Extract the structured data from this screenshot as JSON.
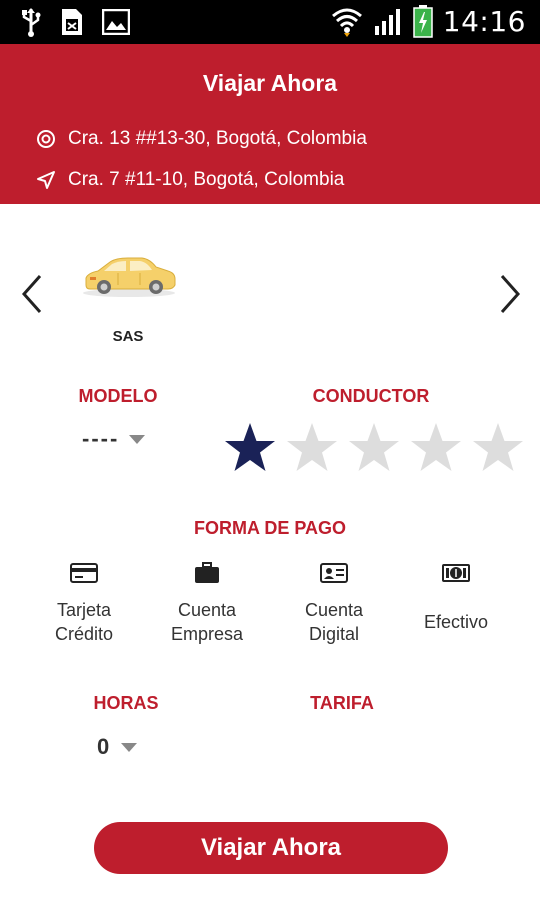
{
  "status_bar": {
    "time": "14:16",
    "icons": [
      "usb-icon",
      "sim-card-icon",
      "image-icon",
      "wifi-icon",
      "signal-icon",
      "battery-icon"
    ]
  },
  "header": {
    "title": "Viajar Ahora",
    "origin_address": "Cra. 13 ##13-30, Bogotá, Colombia",
    "destination_address": "Cra. 7 #11-10, Bogotá, Colombia"
  },
  "vehicle": {
    "selected_label": "SAS",
    "icon": "taxi-car-icon"
  },
  "modelo": {
    "label": "MODELO",
    "value": "----"
  },
  "conductor": {
    "label": "CONDUCTOR",
    "rating": 1,
    "max_rating": 5
  },
  "payment": {
    "label": "FORMA DE PAGO",
    "options": [
      {
        "line1": "Tarjeta",
        "line2": "Crédito",
        "icon": "credit-card-icon"
      },
      {
        "line1": "Cuenta",
        "line2": "Empresa",
        "icon": "briefcase-icon"
      },
      {
        "line1": "Cuenta",
        "line2": "Digital",
        "icon": "id-card-icon"
      },
      {
        "line1": "Efectivo",
        "icon": "cash-icon"
      }
    ]
  },
  "horas": {
    "label": "HORAS",
    "value": "0"
  },
  "tarifa": {
    "label": "TARIFA"
  },
  "cta": {
    "label": "Viajar Ahora"
  },
  "colors": {
    "brand_red": "#be1e2d",
    "star_active": "#1a2257",
    "star_inactive": "#dddddd"
  }
}
